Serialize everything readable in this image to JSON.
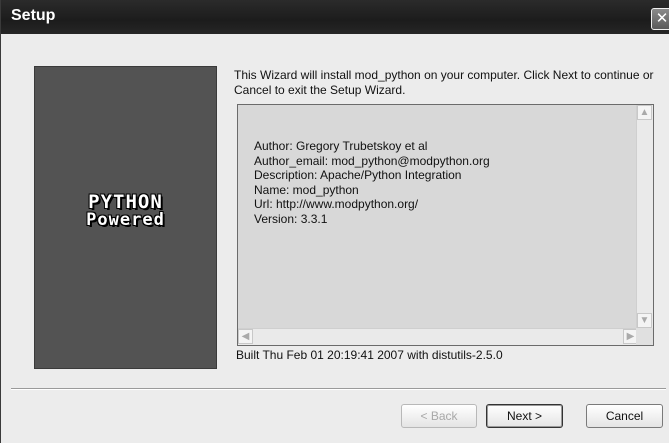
{
  "window": {
    "title": "Setup",
    "close_symbol": "✕"
  },
  "logo": {
    "line1": "PYTHON",
    "line2": "Powered"
  },
  "intro_text": "This Wizard will install mod_python on your computer. Click Next to continue or Cancel to exit the Setup Wizard.",
  "info": {
    "lines": [
      "Author: Gregory Trubetskoy et al",
      "Author_email: mod_python@modpython.org",
      "Description: Apache/Python Integration",
      "Name: mod_python",
      "Url: http://www.modpython.org/",
      "Version: 3.3.1"
    ]
  },
  "built_text": "Built Thu Feb 01 20:19:41 2007 with distutils-2.5.0",
  "buttons": {
    "back": "< Back",
    "next": "Next >",
    "cancel": "Cancel"
  },
  "scroll_icons": {
    "up": "up-arrow-icon",
    "down": "down-arrow-icon",
    "left": "left-arrow-icon",
    "right": "right-arrow-icon"
  }
}
